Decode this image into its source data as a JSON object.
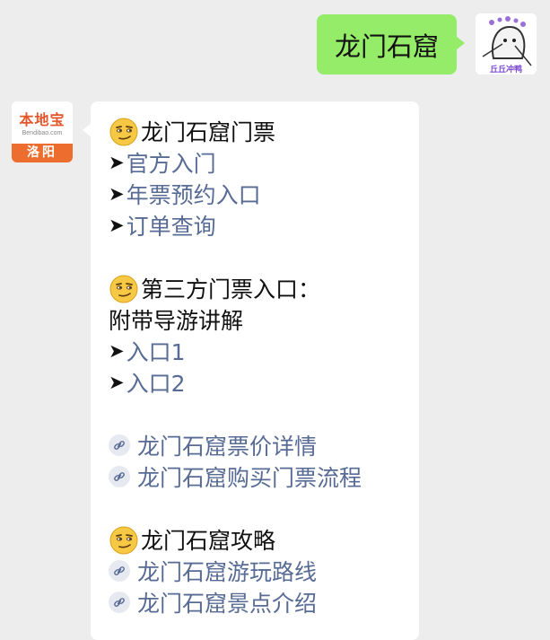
{
  "outgoing": {
    "text": "龙门石窟",
    "avatar_text": "丘丘冲鸭"
  },
  "incoming": {
    "avatar": {
      "logo_title": "本地宝",
      "logo_sub": "Bendibao.com",
      "city": "洛阳"
    },
    "tickets_heading": "龙门石窟门票",
    "official_link": "官方入门",
    "annual_link": "年票预约入口",
    "order_link": "订单查询",
    "thirdparty_heading": "第三方门票入口：",
    "guide_note": "附带导游讲解",
    "entry1_link": "入口1",
    "entry2_link": "入口2",
    "price_link": "龙门石窟票价详情",
    "buy_link": "龙门石窟购买门票流程",
    "guide_heading": "龙门石窟攻略",
    "route_link": "龙门石窟游玩路线",
    "spots_link": "龙门石窟景点介绍",
    "arrow_glyph": "➤"
  },
  "colors": {
    "background": "#ededed",
    "outgoing_bubble": "#95ec69",
    "incoming_bubble": "#ffffff",
    "link": "#576b95",
    "brand_orange": "#ec6d2e"
  },
  "icons": {
    "emoji": "smirking-face-emoji",
    "link": "chain-link-icon",
    "arrow": "arrowhead-icon"
  }
}
